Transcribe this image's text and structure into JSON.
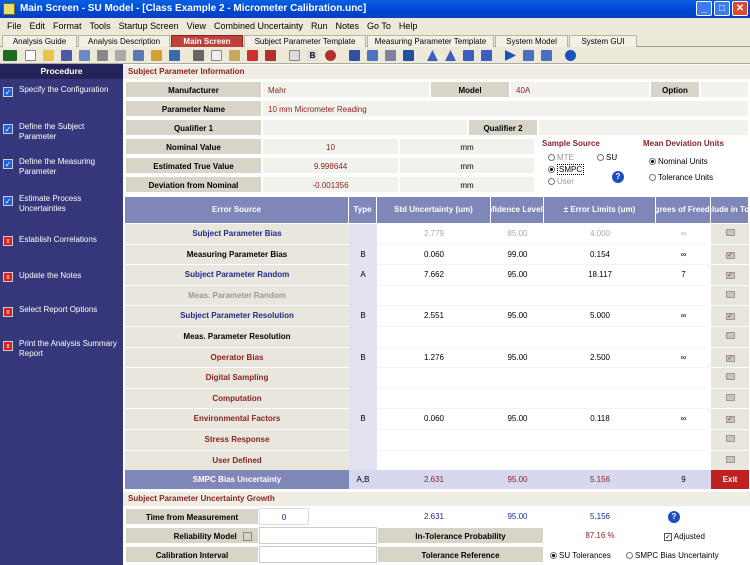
{
  "window": {
    "title": "Main Screen - SU Model - [Class Example 2 - Micrometer Calibration.unc]"
  },
  "menu": [
    "File",
    "Edit",
    "Format",
    "Tools",
    "Startup Screen",
    "View",
    "Combined Uncertainty",
    "Run",
    "Notes",
    "Go To",
    "Help"
  ],
  "tabs": [
    "Analysis Guide",
    "Analysis Description",
    "Main Screen",
    "Subject Parameter Template",
    "Measuring Parameter Template",
    "System Model",
    "System GUI"
  ],
  "sidebar": {
    "header": "Procedure",
    "steps": [
      {
        "label": "Specify the Configuration",
        "done": true
      },
      {
        "label": "Define the Subject Parameter",
        "done": true
      },
      {
        "label": "Define the Measuring Parameter",
        "done": true
      },
      {
        "label": "Estimate Process Uncertainties",
        "done": true
      },
      {
        "label": "Establish Correlations",
        "done": false
      },
      {
        "label": "Update the Notes",
        "done": false
      },
      {
        "label": "Select Report Options",
        "done": false
      },
      {
        "label": "Print the Analysis Summary Report",
        "done": false
      }
    ]
  },
  "info": {
    "section": "Subject Parameter Information",
    "manufacturer_label": "Manufacturer",
    "manufacturer": "Mahr",
    "model_label": "Model",
    "model": "40A",
    "option_label": "Option",
    "param_label": "Parameter Name",
    "param": "10 mm Micrometer Reading",
    "q1_label": "Qualifier 1",
    "q2_label": "Qualifier 2",
    "nominal_label": "Nominal Value",
    "nominal": "10",
    "nominal_unit": "mm",
    "etv_label": "Estimated True Value",
    "etv": "9.998644",
    "etv_unit": "mm",
    "dev_label": "Deviation from Nominal",
    "dev": "-0.001356",
    "dev_unit": "mm"
  },
  "sample_source": {
    "title": "Sample Source",
    "mte": "MTE",
    "su": "SU",
    "smpc": "SMPC",
    "user": "User"
  },
  "mean_dev": {
    "title": "Mean Deviation Units",
    "nominal": "Nominal Units",
    "tolerance": "Tolerance Units"
  },
  "table": {
    "headers": {
      "src": "Error Source",
      "type": "Type",
      "std": "Std Uncertainty (um)",
      "conf": "Confidence Level (%)",
      "lim": "± Error Limits (um)",
      "dof": "Degrees of Freedom",
      "incl": "Include in Total"
    },
    "rows": [
      {
        "name": "Subject Parameter Bias",
        "type": "",
        "std": "2.779",
        "conf": "85.00",
        "lim": "4.000",
        "dof": "∞",
        "color": "#1E2A8C",
        "dim": true
      },
      {
        "name": "Measuring Parameter Bias",
        "type": "B",
        "std": "0.060",
        "conf": "99.00",
        "lim": "0.154",
        "dof": "∞",
        "color": "#000",
        "dim": false,
        "chk": true
      },
      {
        "name": "Subject Parameter Random",
        "type": "A",
        "std": "7.662",
        "conf": "95.00",
        "lim": "18.117",
        "dof": "7",
        "color": "#1E2A8C",
        "dim": false,
        "chk": true
      },
      {
        "name": "Meas. Parameter Random",
        "type": "",
        "std": "",
        "conf": "",
        "lim": "",
        "dof": "",
        "color": "#999",
        "dim": false
      },
      {
        "name": "Subject Parameter Resolution",
        "type": "B",
        "std": "2.551",
        "conf": "95.00",
        "lim": "5.000",
        "dof": "∞",
        "color": "#1E2A8C",
        "dim": false,
        "chk": true
      },
      {
        "name": "Meas. Parameter Resolution",
        "type": "",
        "std": "",
        "conf": "",
        "lim": "",
        "dof": "",
        "color": "#000",
        "dim": false
      },
      {
        "name": "Operator Bias",
        "type": "B",
        "std": "1.276",
        "conf": "95.00",
        "lim": "2.500",
        "dof": "∞",
        "color": "#8B2323",
        "dim": false,
        "chk": true
      },
      {
        "name": "Digital Sampling",
        "type": "",
        "std": "",
        "conf": "",
        "lim": "",
        "dof": "",
        "color": "#8B2323",
        "dim": false
      },
      {
        "name": "Computation",
        "type": "",
        "std": "",
        "conf": "",
        "lim": "",
        "dof": "",
        "color": "#8B2323",
        "dim": false
      },
      {
        "name": "Environmental Factors",
        "type": "B",
        "std": "0.060",
        "conf": "95.00",
        "lim": "0.118",
        "dof": "∞",
        "color": "#8B2323",
        "dim": false,
        "chk": true
      },
      {
        "name": "Stress Response",
        "type": "",
        "std": "",
        "conf": "",
        "lim": "",
        "dof": "",
        "color": "#8B2323",
        "dim": false
      },
      {
        "name": "User Defined",
        "type": "",
        "std": "",
        "conf": "",
        "lim": "",
        "dof": "",
        "color": "#8B2323",
        "dim": false
      }
    ],
    "total": {
      "name": "SMPC Bias Uncertainty",
      "type": "A,B",
      "std": "2.631",
      "conf": "95.00",
      "lim": "5.156",
      "dof": "9",
      "exit": "Exit"
    }
  },
  "growth": {
    "section": "Subject Parameter Uncertainty Growth",
    "time_label": "Time from Measurement",
    "time": "0",
    "std": "2.631",
    "conf": "95.00",
    "lim": "5.156",
    "rel_label": "Reliability Model",
    "itp_label": "In-Tolerance Probability",
    "itp": "87.16 %",
    "adjusted": "Adjusted",
    "cal_label": "Calibration Interval",
    "tol_label": "Tolerance Reference",
    "su_tol": "SU Tolerances",
    "smpc_tol": "SMPC Bias Uncertainty"
  }
}
